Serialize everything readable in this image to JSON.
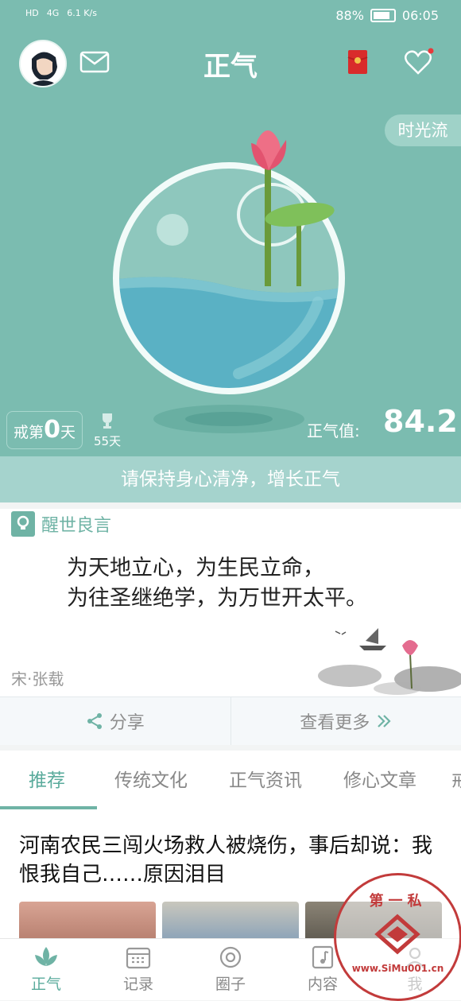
{
  "status_bar": {
    "left_items": [
      "HD",
      "4G",
      "6.1 K/s"
    ],
    "battery": "88%",
    "time": "06:05"
  },
  "header": {
    "title": "正气",
    "icons": [
      "avatar",
      "mail-icon",
      "red-envelope-icon",
      "heart-icon"
    ]
  },
  "hero": {
    "time_flow_button": "时光流",
    "abstain_prefix": "戒第",
    "abstain_days": "0",
    "abstain_suffix": "天",
    "best_record": "55天",
    "zhengqi_label": "正气值:",
    "zhengqi_value": "84.2",
    "banner": "请保持身心清净，增长正气"
  },
  "quote": {
    "tag": "醒世良言",
    "line1": "为天地立心，为生民立命，",
    "line2": "为往圣继绝学，为万世开太平。",
    "author": "宋·张载",
    "share_label": "分享",
    "more_label": "查看更多"
  },
  "tabs": [
    "推荐",
    "传统文化",
    "正气资讯",
    "修心文章",
    "戒"
  ],
  "article": {
    "title": "河南农民三闯火场救人被烧伤，事后却说：我恨我自己……原因泪目"
  },
  "bottom_nav": [
    "正气",
    "记录",
    "圈子",
    "内容",
    "我"
  ],
  "watermark": {
    "top": "第一私",
    "bottom": "www.SiMu001.cn"
  },
  "colors": {
    "primary": "#7bbcb0",
    "accent": "#5aab9c",
    "banner": "#a5d3cd",
    "lotus": "#ee6f86"
  }
}
